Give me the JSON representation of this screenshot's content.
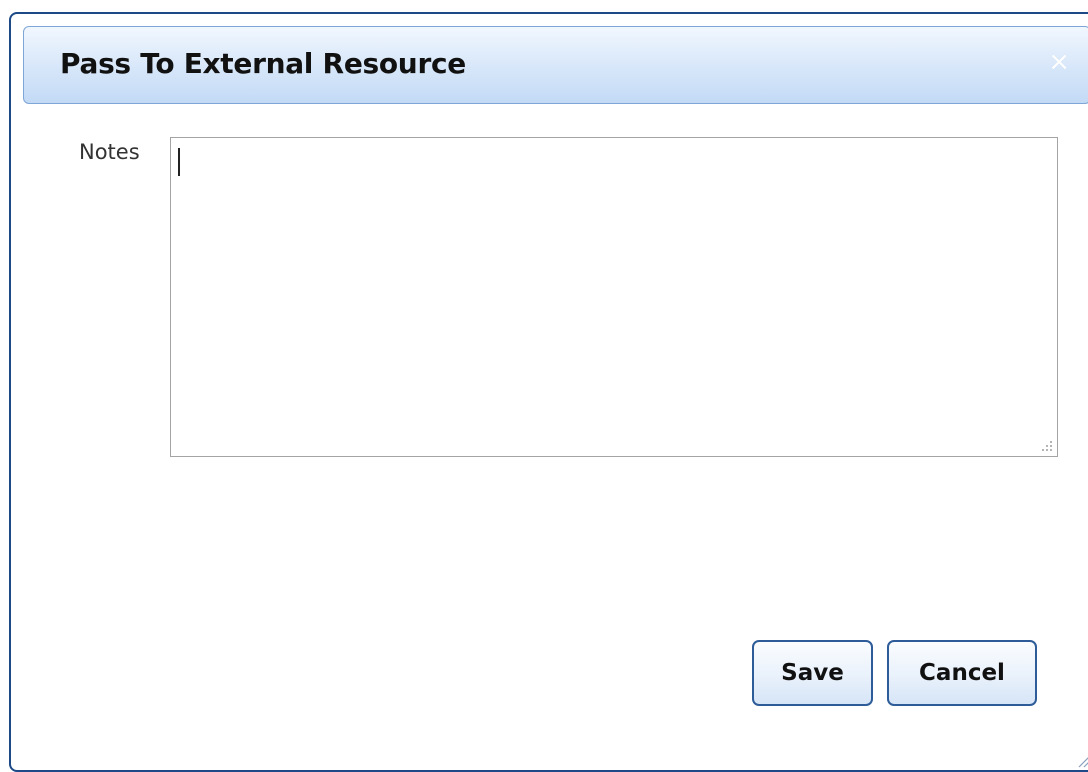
{
  "dialog": {
    "title": "Pass To External Resource",
    "close_glyph": "×"
  },
  "form": {
    "notes_label": "Notes",
    "notes_value": ""
  },
  "buttons": {
    "save_label": "Save",
    "cancel_label": "Cancel"
  },
  "colors": {
    "border": "#1d4a86",
    "titlebar_top": "#f1f7fe",
    "titlebar_bottom": "#c3daf6",
    "button_border": "#2e5c98"
  },
  "icons": [
    "close-icon",
    "resize-grip-icon"
  ]
}
